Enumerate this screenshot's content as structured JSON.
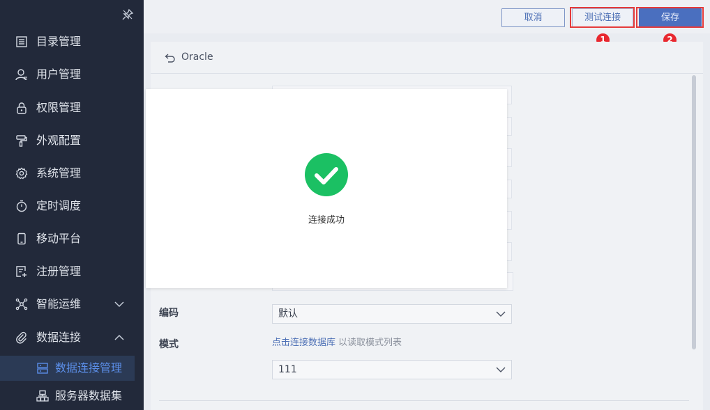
{
  "sidebar": {
    "items": [
      {
        "label": "目录管理",
        "icon": "catalog-icon"
      },
      {
        "label": "用户管理",
        "icon": "user-icon"
      },
      {
        "label": "权限管理",
        "icon": "lock-icon"
      },
      {
        "label": "外观配置",
        "icon": "paint-roller-icon"
      },
      {
        "label": "系统管理",
        "icon": "gear-icon"
      },
      {
        "label": "定时调度",
        "icon": "stopwatch-icon"
      },
      {
        "label": "移动平台",
        "icon": "mobile-icon"
      },
      {
        "label": "注册管理",
        "icon": "register-icon"
      },
      {
        "label": "智能运维",
        "icon": "ops-icon"
      },
      {
        "label": "数据连接",
        "icon": "link-icon"
      }
    ],
    "sub_items": [
      {
        "label": "数据连接管理",
        "icon": "database-icon",
        "active": true
      },
      {
        "label": "服务器数据集",
        "icon": "server-dataset-icon",
        "active": false
      }
    ]
  },
  "toolbar": {
    "cancel_label": "取消",
    "test_label": "测试连接",
    "save_label": "保存",
    "badge_1": "1",
    "badge_2": "2"
  },
  "panel": {
    "title": "Oracle"
  },
  "form": {
    "encoding_label": "编码",
    "encoding_value": "默认",
    "schema_label": "模式",
    "schema_link": "点击连接数据库",
    "schema_hint": "以读取模式列表",
    "schema_value": "111"
  },
  "modal": {
    "message": "连接成功"
  },
  "colors": {
    "sidebar_bg": "#22293a",
    "accent": "#4a6fbf",
    "success": "#1bc063",
    "highlight": "#e53a3a"
  }
}
